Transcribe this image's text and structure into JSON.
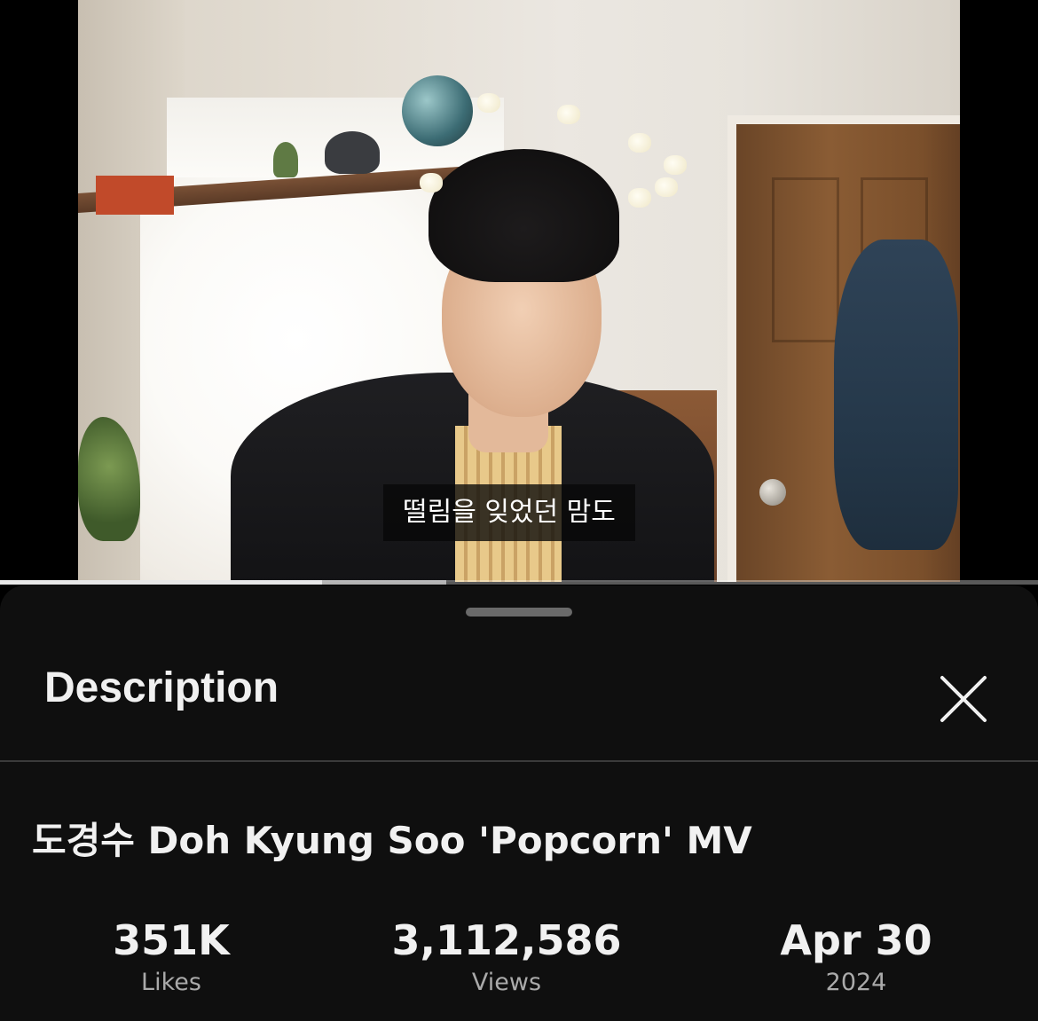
{
  "video": {
    "subtitle": "떨림을 잊었던 맘도",
    "progress_played": 0.31,
    "progress_buffered": 0.43
  },
  "description_panel": {
    "title": "Description",
    "close_icon": "close-icon",
    "video_title": "도경수 Doh Kyung Soo 'Popcorn' MV",
    "stats": [
      {
        "value": "351K",
        "label": "Likes"
      },
      {
        "value": "3,112,586",
        "label": "Views"
      },
      {
        "value": "Apr 30",
        "label": "2024"
      }
    ]
  },
  "colors": {
    "sheet_background": "#0f0f0f",
    "primary_text": "#f1f1f1",
    "secondary_text": "#aaaaaa",
    "divider": "#3a3a3a"
  }
}
